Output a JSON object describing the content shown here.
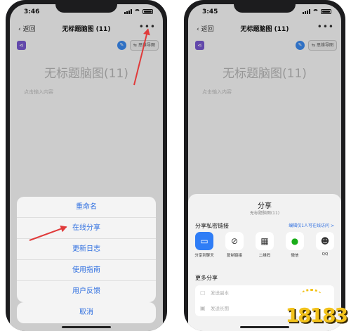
{
  "left": {
    "status": {
      "time": "3:46"
    },
    "nav": {
      "back": "返回",
      "title": "无标题脑图 (11)",
      "more": "•••"
    },
    "toolbar": {
      "mindmap_btn": "思维导图"
    },
    "doc": {
      "title": "无标题脑图(11)",
      "hint": "点击输入内容"
    },
    "sheet": {
      "items": [
        "重命名",
        "在线分享",
        "更新日志",
        "使用指南",
        "用户反馈"
      ],
      "cancel": "取消"
    }
  },
  "right": {
    "status": {
      "time": "3:45"
    },
    "nav": {
      "back": "返回",
      "title": "无标题脑图 (11)",
      "more": "•••"
    },
    "toolbar": {
      "mindmap_btn": "思维导图"
    },
    "doc": {
      "title": "无标题脑图(11)",
      "hint": "点击输入内容"
    },
    "share": {
      "title": "分享",
      "subtitle": "无标题脑图(11)",
      "section_link": "分享私密链接",
      "permission": "编辑仅1人可在线访问 >",
      "targets": [
        {
          "icon": "message-icon",
          "label": "分享到聊天"
        },
        {
          "icon": "link-icon",
          "label": "复制链接"
        },
        {
          "icon": "qrcode-icon",
          "label": "二维码"
        },
        {
          "icon": "wechat-icon",
          "label": "微信"
        },
        {
          "icon": "qq-icon",
          "label": "QQ"
        }
      ],
      "section_more": "更多分享",
      "more_items": [
        "发送副本",
        "发送长图"
      ]
    }
  },
  "watermark": {
    "text": "18183"
  },
  "colors": {
    "accent_blue": "#2f6fe0",
    "arrow_red": "#e03a3a",
    "brand_purple": "#7b5ad6",
    "watermark_yellow": "#f2c21b"
  }
}
